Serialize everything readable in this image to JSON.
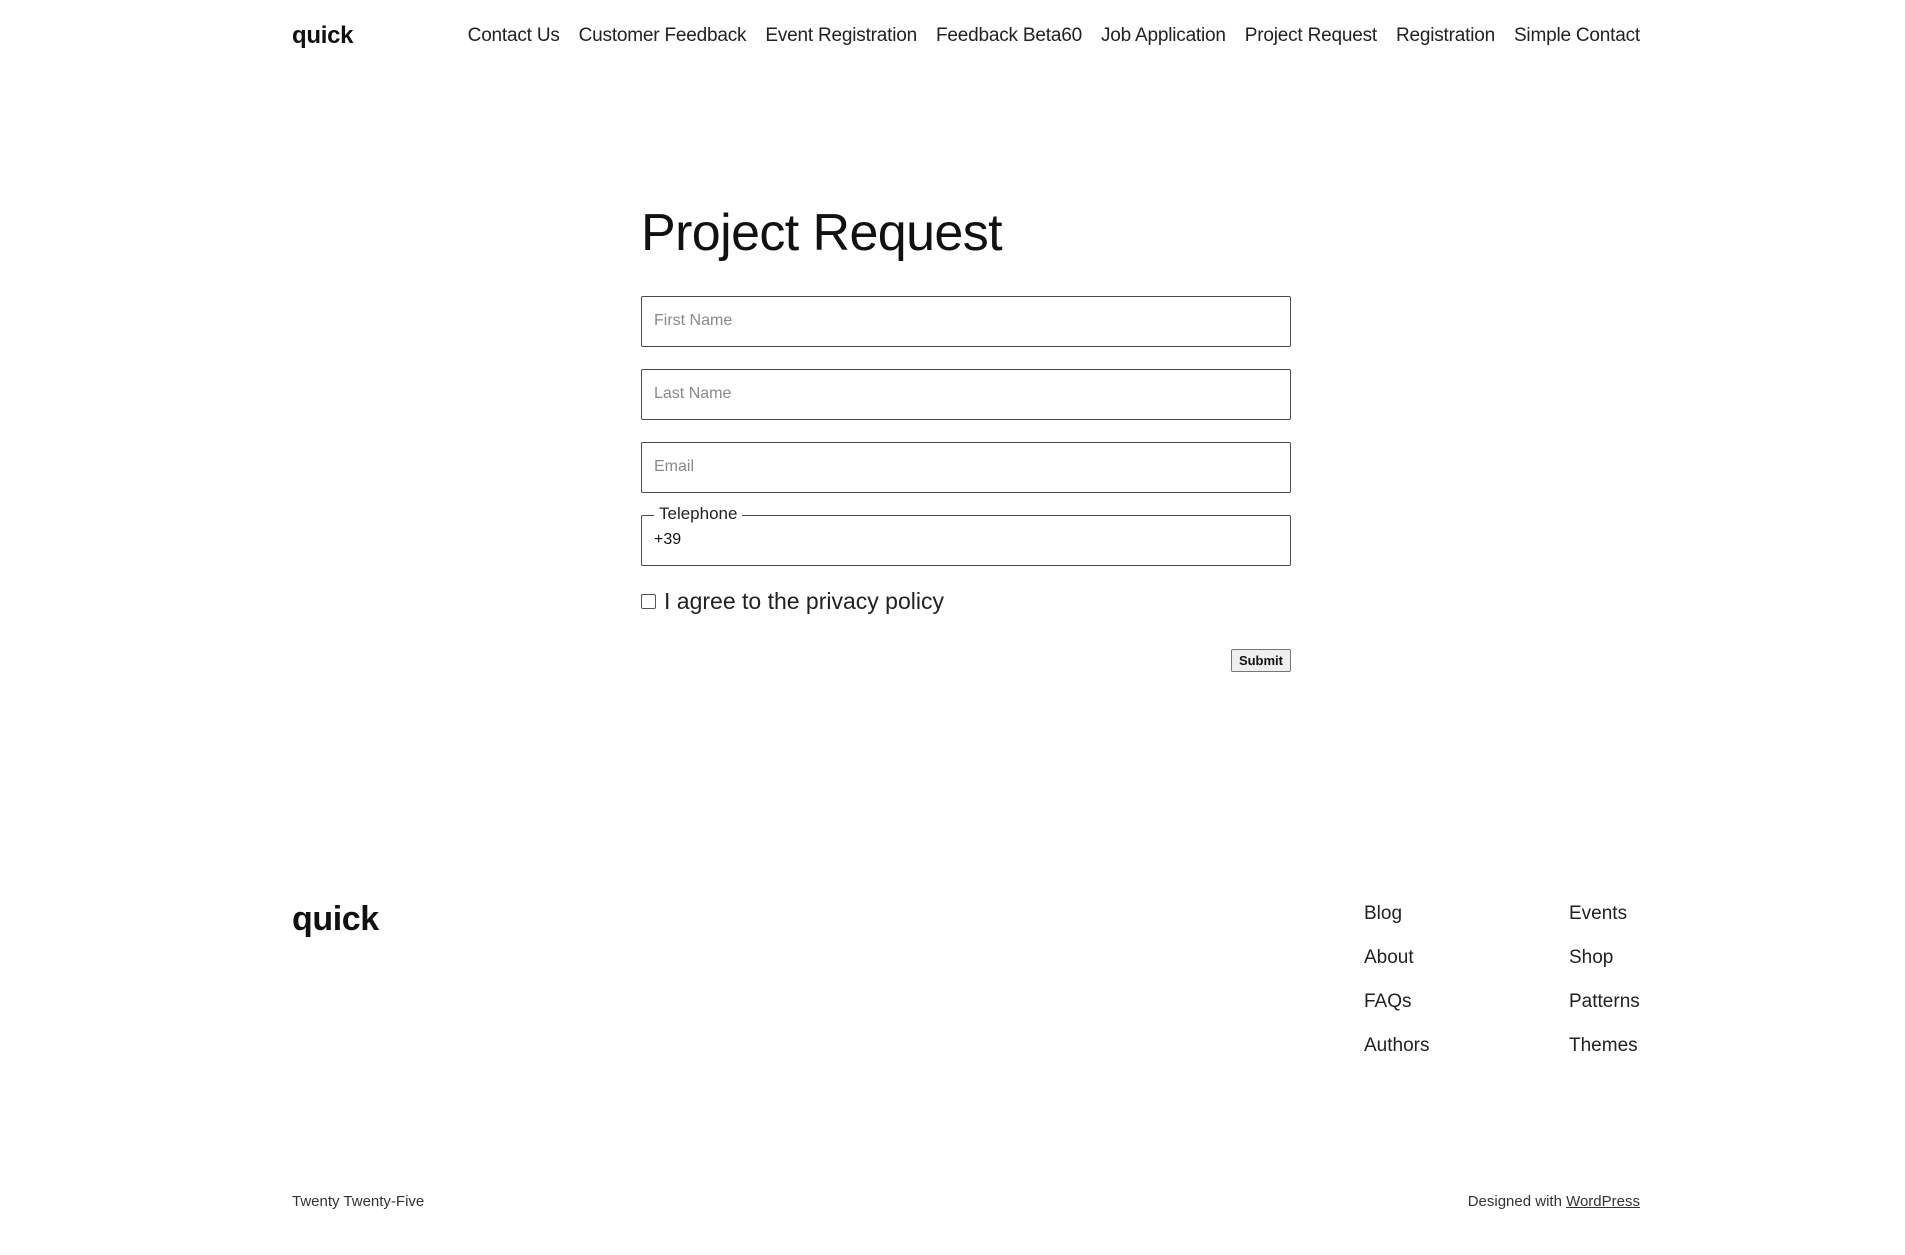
{
  "header": {
    "site_title": "quick",
    "nav": [
      "Contact Us",
      "Customer Feedback",
      "Event Registration",
      "Feedback Beta60",
      "Job Application",
      "Project Request",
      "Registration",
      "Simple Contact"
    ]
  },
  "form": {
    "title": "Project Request",
    "first_name_placeholder": "First Name",
    "last_name_placeholder": "Last Name",
    "email_placeholder": "Email",
    "telephone_label": "Telephone",
    "telephone_value": "+39",
    "consent_label": "I agree to the privacy policy",
    "submit_label": "Submit"
  },
  "footer": {
    "title": "quick",
    "col1": [
      "Blog",
      "About",
      "FAQs",
      "Authors"
    ],
    "col2": [
      "Events",
      "Shop",
      "Patterns",
      "Themes"
    ],
    "theme_name": "Twenty Twenty-Five",
    "designed_with": "Designed with",
    "wordpress_link": "WordPress"
  }
}
